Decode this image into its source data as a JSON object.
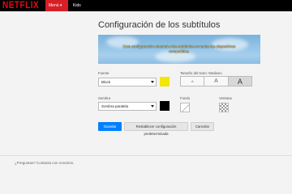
{
  "header": {
    "logo": "NETFLIX",
    "menu_label": "Menú ▾",
    "kids_label": "Kids"
  },
  "page": {
    "title": "Configuración de los subtítulos"
  },
  "preview": {
    "text": "Esta configuración afectará a los subtítulos en todos los dispositivos compatibles."
  },
  "font": {
    "label": "Fuente",
    "value": "Block",
    "color": "#f3e600"
  },
  "text_size": {
    "label": "Tamaño del texto: Mediano",
    "options": [
      "A",
      "A",
      "A"
    ],
    "selected_index": 2
  },
  "shadow": {
    "label": "Sombra",
    "value": "Sombra paralela",
    "color": "#000000"
  },
  "background": {
    "label": "Fondo"
  },
  "window": {
    "label": "Ventana"
  },
  "actions": {
    "save": "Guardar",
    "reset": "Restablecer configuración predeterminada",
    "cancel": "Cancelar"
  },
  "footer": {
    "text": "¿Preguntas? Contacta con nosotros."
  },
  "colors": {
    "brand": "#e50914",
    "primary_button": "#0080ff"
  }
}
